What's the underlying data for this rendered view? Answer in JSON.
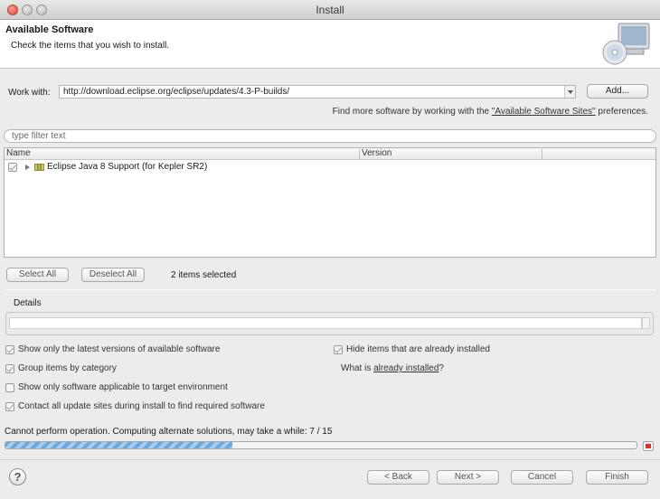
{
  "window": {
    "title": "Install"
  },
  "banner": {
    "title": "Available Software",
    "description": "Check the items that you wish to install."
  },
  "work_with": {
    "label": "Work with:",
    "value": "http://download.eclipse.org/eclipse/updates/4.3-P-builds/",
    "add_label": "Add...",
    "hint_prefix": "Find more software by working with the ",
    "hint_link": "\"Available Software Sites\"",
    "hint_suffix": " preferences."
  },
  "filter": {
    "placeholder": "type filter text"
  },
  "table": {
    "columns": [
      "Name",
      "Version"
    ],
    "rows": [
      {
        "label": "Eclipse Java 8 Support (for Kepler SR2)",
        "checked": true
      }
    ]
  },
  "selection": {
    "select_all": "Select All",
    "deselect_all": "Deselect All",
    "count": "2 items selected"
  },
  "details": {
    "label": "Details"
  },
  "options": {
    "latest_versions": "Show only the latest versions of available software",
    "group_by_category": "Group items by category",
    "target_env": "Show only software applicable to target environment",
    "contact_sites": "Contact all update sites during install to find required software",
    "hide_installed": "Hide items that are already installed",
    "what_is_prefix": "What is ",
    "what_is_link": "already installed",
    "what_is_suffix": "?"
  },
  "status": {
    "text": "Cannot perform operation. Computing alternate solutions, may take a while: 7 / 15",
    "progress": 0.36
  },
  "footer": {
    "help": "?",
    "back": "< Back",
    "next": "Next >",
    "cancel": "Cancel",
    "finish": "Finish"
  },
  "colors": {
    "progress": "#6aa9e0",
    "stop": "#d9342b"
  }
}
